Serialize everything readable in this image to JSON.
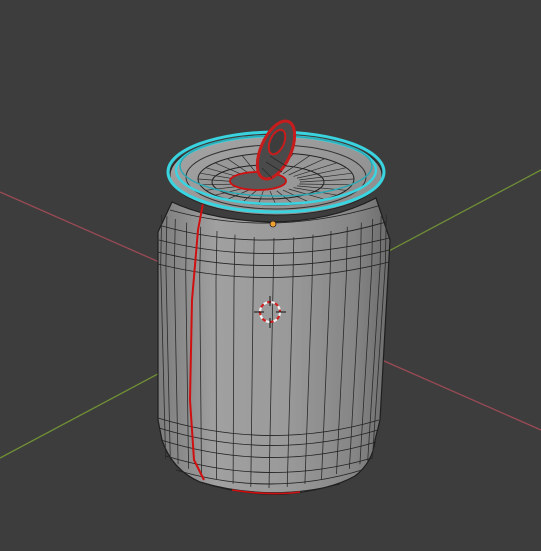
{
  "viewport": {
    "background": "#3d3d3d",
    "x_axis_color": "#9a4a55",
    "y_axis_color": "#6f8f35"
  },
  "object": {
    "kind": "soda-can-mesh",
    "base_color": "#9a9a9a",
    "wire_color": "#1e1e1e",
    "seam_color": "#d01010",
    "rim_selection_color": "#39d4e0",
    "pull_tab_color": "#c81c1c",
    "origin_color": "#f0a030"
  },
  "cursor": {
    "icon": "3d-cursor-icon",
    "ring_colors": [
      "#d02020",
      "#f0f0f0"
    ]
  }
}
